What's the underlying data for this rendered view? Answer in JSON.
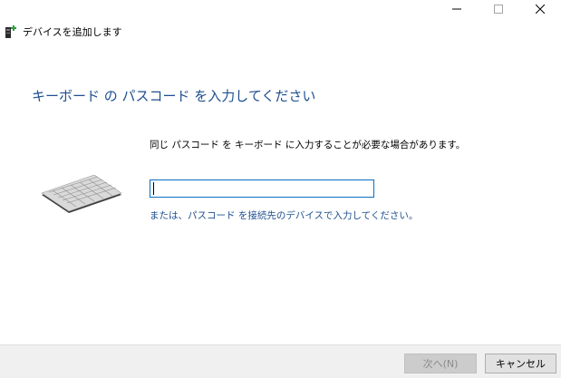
{
  "window": {
    "title": "デバイスを追加します",
    "caption_icons": [
      "minimize-icon",
      "maximize-icon",
      "close-icon"
    ]
  },
  "main": {
    "heading": "キーボード の パスコード を入力してください",
    "instruction": "同じ パスコード を キーボード に入力することが必要な場合があります。",
    "passcode_value": "",
    "alt_link": "または、パスコード を接続先のデバイスで入力してください。"
  },
  "footer": {
    "next_label": "次へ(N)",
    "cancel_label": "キャンセル"
  },
  "colors": {
    "heading": "#1e4f8f",
    "link": "#1e4f8f",
    "input_border": "#0a6fc2",
    "footer_bg": "#f0f0f0"
  }
}
